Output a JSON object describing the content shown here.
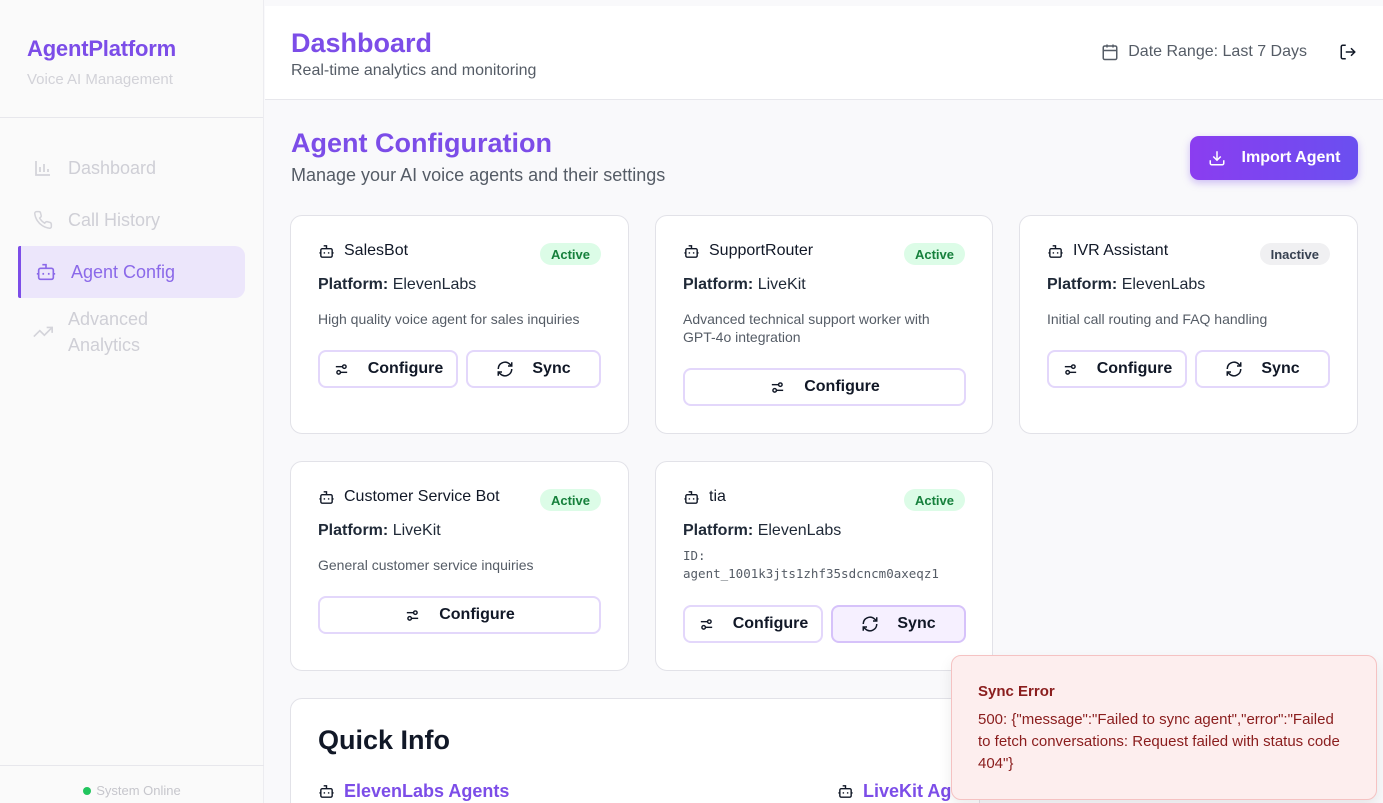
{
  "sidebar": {
    "brand_title": "AgentPlatform",
    "brand_subtitle": "Voice AI Management",
    "items": [
      {
        "label": "Dashboard",
        "icon": "bar-chart-icon"
      },
      {
        "label": "Call History",
        "icon": "phone-icon"
      },
      {
        "label": "Agent Config",
        "icon": "bot-icon",
        "active": true
      },
      {
        "label": "Advanced Analytics",
        "icon": "trending-up-icon"
      }
    ],
    "status": "System Online"
  },
  "header": {
    "title": "Dashboard",
    "subtitle": "Real-time analytics and monitoring",
    "date_range": "Date Range: Last 7 Days",
    "date_icon": "calendar-icon",
    "logout_icon": "logout-icon"
  },
  "main": {
    "title": "Agent Configuration",
    "subtitle": "Manage your AI voice agents and their settings",
    "import_label": "Import Agent",
    "platform_label": "Platform:",
    "configure_label": "Configure",
    "sync_label": "Sync",
    "agents": [
      {
        "name": "SalesBot",
        "status": "Active",
        "platform": "ElevenLabs",
        "description": "High quality voice agent for sales inquiries"
      },
      {
        "name": "SupportRouter",
        "status": "Active",
        "platform": "LiveKit",
        "description": "Advanced technical support worker with GPT-4o integration"
      },
      {
        "name": "IVR Assistant",
        "status": "Inactive",
        "platform": "ElevenLabs",
        "description": "Initial call routing and FAQ handling"
      },
      {
        "name": "Customer Service Bot",
        "status": "Active",
        "platform": "LiveKit",
        "description": "General customer service inquiries"
      },
      {
        "name": "tia",
        "status": "Active",
        "platform": "ElevenLabs",
        "id_label": "ID:",
        "id_value": "agent_1001k3jts1zhf35sdcncm0axeqz1"
      }
    ]
  },
  "quick_info": {
    "title": "Quick Info",
    "elevenlabs_label": "ElevenLabs Agents",
    "livekit_label": "LiveKit Age"
  },
  "toast": {
    "title": "Sync Error",
    "message": "500: {\"message\":\"Failed to sync agent\",\"error\":\"Failed to fetch conversations: Request failed with status code 404\"}"
  },
  "colors": {
    "accent": "#7c4de8",
    "active_badge_bg": "#dcfce7",
    "active_badge_text": "#16803c",
    "error_bg": "#fdeeee",
    "error_text": "#8a1d1d"
  }
}
